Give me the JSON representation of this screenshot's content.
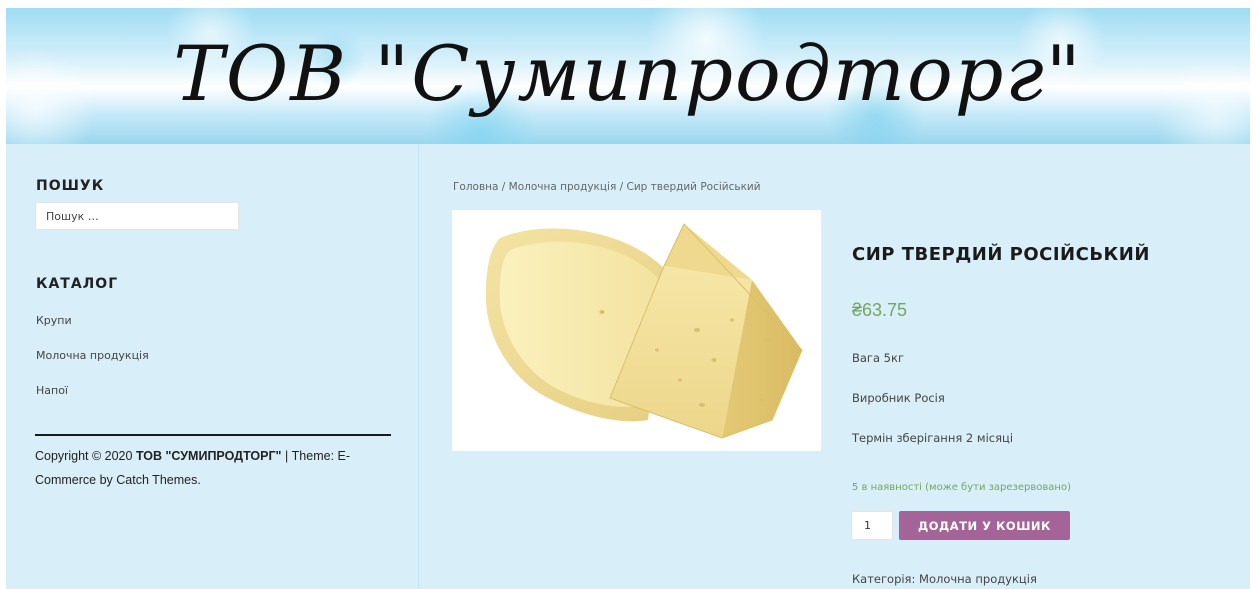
{
  "header": {
    "site_title": "ТОВ \"Сумипродторг\""
  },
  "sidebar": {
    "search_title": "ПОШУК",
    "search_placeholder": "Пошук …",
    "catalog_title": "КАТАЛОГ",
    "catalog_items": [
      {
        "label": "Крупи"
      },
      {
        "label": "Молочна продукція"
      },
      {
        "label": "Напої"
      }
    ],
    "copyright_prefix": "Copyright © 2020 ",
    "copyright_site": "ТОВ \"СУМИПРОДТОРГ\"",
    "copyright_middle": " | Theme: ",
    "copyright_theme": "E-Commerce",
    "copyright_by": " by ",
    "copyright_author": "Catch Themes",
    "copyright_end": "."
  },
  "breadcrumb": {
    "home": "Головна",
    "separator": " / ",
    "category": "Молочна продукція",
    "current": "Сир твердий Російський"
  },
  "product": {
    "title": "СИР ТВЕРДИЙ РОСІЙСЬКИЙ",
    "price": "₴63.75",
    "weight": "Вага 5кг",
    "manufacturer": "Виробник Росія",
    "shelf_life": "Термін зберігання 2 місяці",
    "stock": "5 в наявності (може бути зарезервовано)",
    "quantity": "1",
    "add_to_cart": "ДОДАТИ У КОШИК",
    "category_label": "Категорія: ",
    "category_value": "Молочна продукція"
  },
  "colors": {
    "page_bg": "#d8eef8",
    "price": "#77a464",
    "button": "#a46497"
  }
}
